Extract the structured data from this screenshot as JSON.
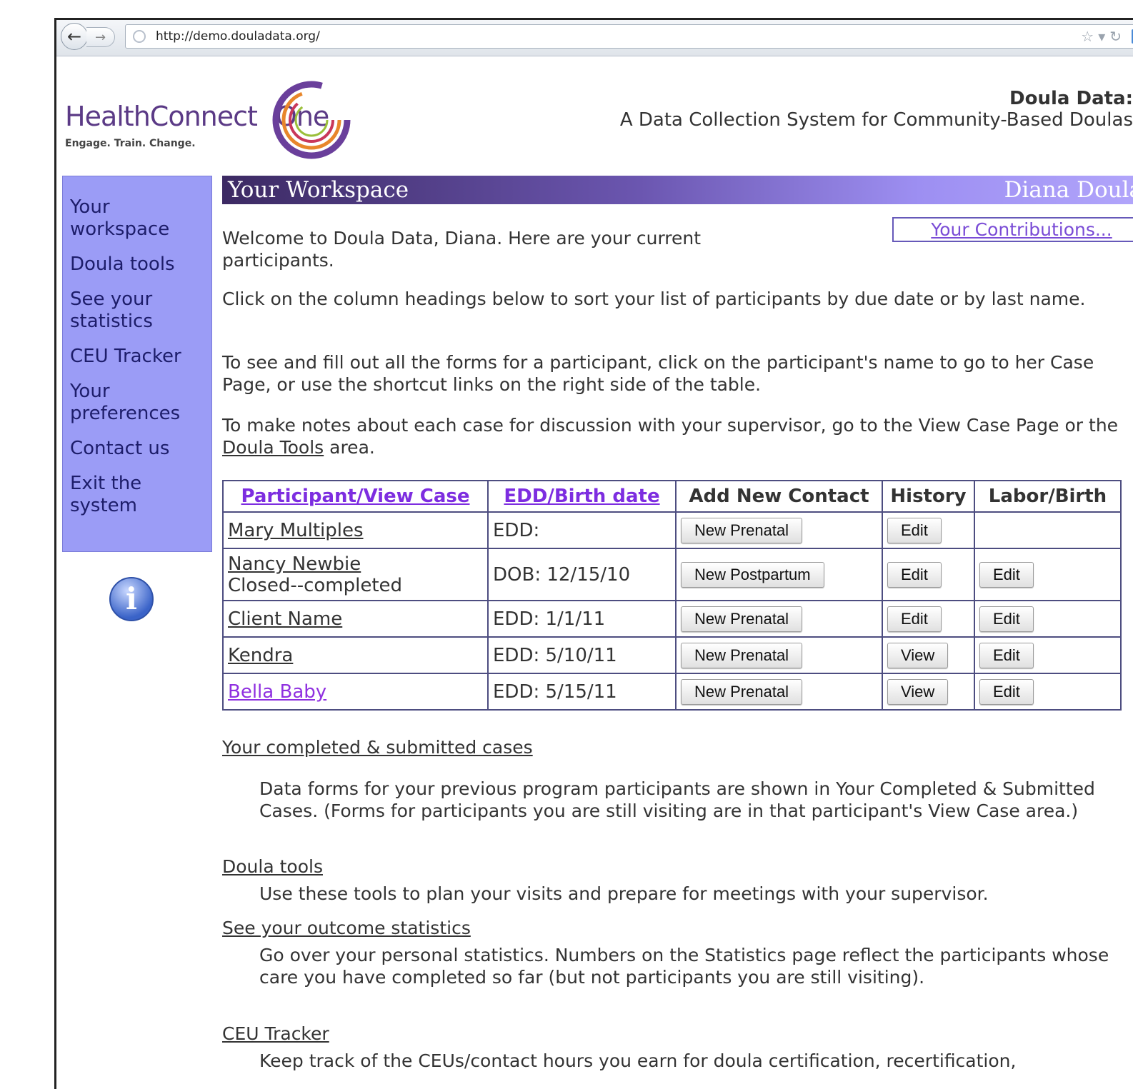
{
  "browser": {
    "url": "http://demo.douladata.org/"
  },
  "logo": {
    "name_part1": "HealthConnect",
    "name_part2": "One",
    "tagline": "Engage. Train. Change."
  },
  "header": {
    "title": "Doula Data:",
    "subtitle": "A Data Collection System for Community-Based Doulas"
  },
  "sidebar": {
    "items": [
      {
        "label": "Your workspace"
      },
      {
        "label": "Doula tools"
      },
      {
        "label": "See your statistics"
      },
      {
        "label": "CEU Tracker"
      },
      {
        "label": "Your preferences"
      },
      {
        "label": "Contact us"
      },
      {
        "label": "Exit the system"
      }
    ]
  },
  "workspace": {
    "title": "Your Workspace",
    "user": "Diana Doula",
    "contributions_label": "Your Contributions...",
    "intro": "Welcome to Doula Data, Diana. Here are your current participants.",
    "sort_hint": "Click on the column headings below to sort your list of participants by due date or by last name.",
    "forms_hint": "To see and fill out all the forms for a participant, click on the participant's name to go to her Case Page, or use the shortcut links on the right side of the table.",
    "notes_hint_before": "To make notes about each case for discussion with your supervisor, go to the View Case Page or the ",
    "notes_hint_link": "Doula Tools",
    "notes_hint_after": " area."
  },
  "table": {
    "headers": [
      "Participant/View Case",
      "EDD/Birth date",
      "Add New Contact",
      "History",
      "Labor/Birth"
    ],
    "rows": [
      {
        "name": "Mary Multiples",
        "status": "",
        "date": "EDD:",
        "contact": "New Prenatal",
        "history": "Edit",
        "labor": ""
      },
      {
        "name": "Nancy Newbie",
        "status": "Closed--completed",
        "date": "DOB: 12/15/10",
        "contact": "New Postpartum",
        "history": "Edit",
        "labor": "Edit"
      },
      {
        "name": "Client Name",
        "status": "",
        "date": "EDD: 1/1/11",
        "contact": "New Prenatal",
        "history": "Edit",
        "labor": "Edit"
      },
      {
        "name": "Kendra",
        "status": "",
        "date": "EDD: 5/10/11",
        "contact": "New Prenatal",
        "history": "View",
        "labor": "Edit"
      },
      {
        "name": "Bella Baby",
        "status": "",
        "date": "EDD: 5/15/11",
        "contact": "New Prenatal",
        "history": "View",
        "labor": "Edit"
      }
    ]
  },
  "sections": [
    {
      "link": "Your completed & submitted cases",
      "desc": "Data forms for your previous program participants are shown in Your Completed & Submitted Cases. (Forms for participants you are still visiting are in that participant's View Case area.)"
    },
    {
      "link": "Doula tools",
      "desc": "Use these tools to plan your visits and prepare for meetings with your supervisor."
    },
    {
      "link": "See your outcome statistics",
      "desc": "Go over your personal statistics. Numbers on the Statistics page reflect the participants whose care you have completed so far (but not participants you are still visiting)."
    },
    {
      "link": "CEU Tracker",
      "desc": "Keep track of the CEUs/contact hours you earn for doula certification, recertification,"
    }
  ],
  "colors": {
    "sidebar_bg": "#9b9cf6",
    "banner_start": "#3c2a63",
    "banner_end": "#b2a6fb",
    "link_purple": "#7d2de0"
  }
}
